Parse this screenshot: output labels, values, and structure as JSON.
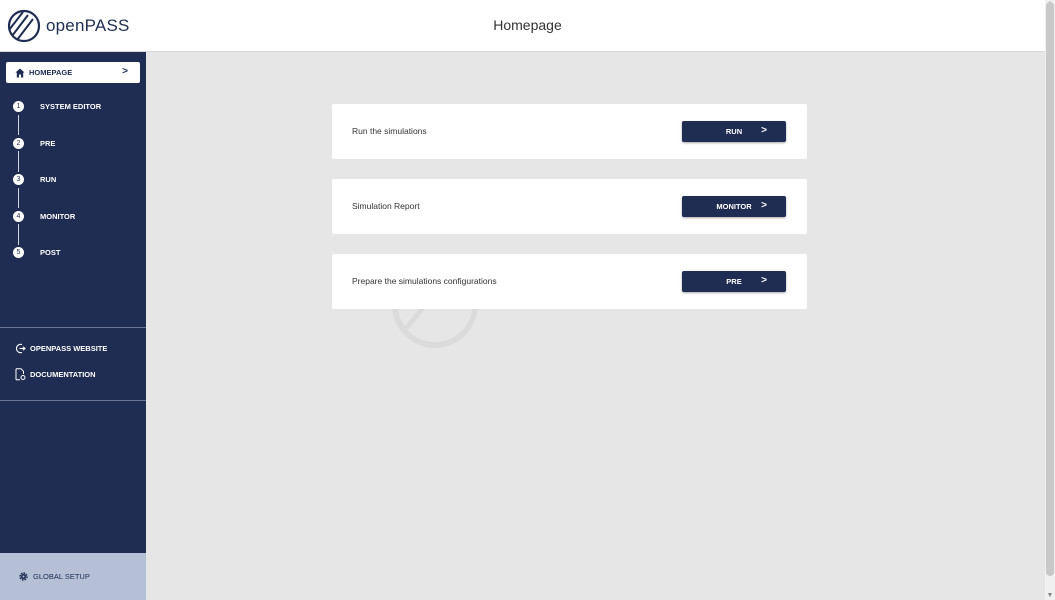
{
  "header": {
    "logo_text_a": "open",
    "logo_text_b": "PASS",
    "title": "Homepage"
  },
  "sidebar": {
    "home": {
      "label": "HOMEPAGE",
      "arrow": ">"
    },
    "steps": [
      {
        "number": "1",
        "label": "SYSTEM EDITOR"
      },
      {
        "number": "2",
        "label": "PRE"
      },
      {
        "number": "3",
        "label": "RUN"
      },
      {
        "number": "4",
        "label": "MONITOR"
      },
      {
        "number": "5",
        "label": "POST"
      }
    ],
    "links": [
      {
        "label": "OPENPASS WEBSITE",
        "icon": "external-link-icon"
      },
      {
        "label": "DOCUMENTATION",
        "icon": "document-settings-icon"
      }
    ],
    "global_setup": {
      "label": "GLOBAL SETUP",
      "icon": "gear-icon"
    }
  },
  "cards": [
    {
      "text": "Run the simulations",
      "button": "RUN",
      "arrow": ">"
    },
    {
      "text": "Simulation Report",
      "button": "MONITOR",
      "arrow": ">"
    },
    {
      "text": "Prepare the simulations configurations",
      "button": "PRE",
      "arrow": ">"
    }
  ],
  "colors": {
    "primary": "#1f2d52",
    "background": "#e6e6e6",
    "global_setup_bg": "#b5bfd6"
  }
}
